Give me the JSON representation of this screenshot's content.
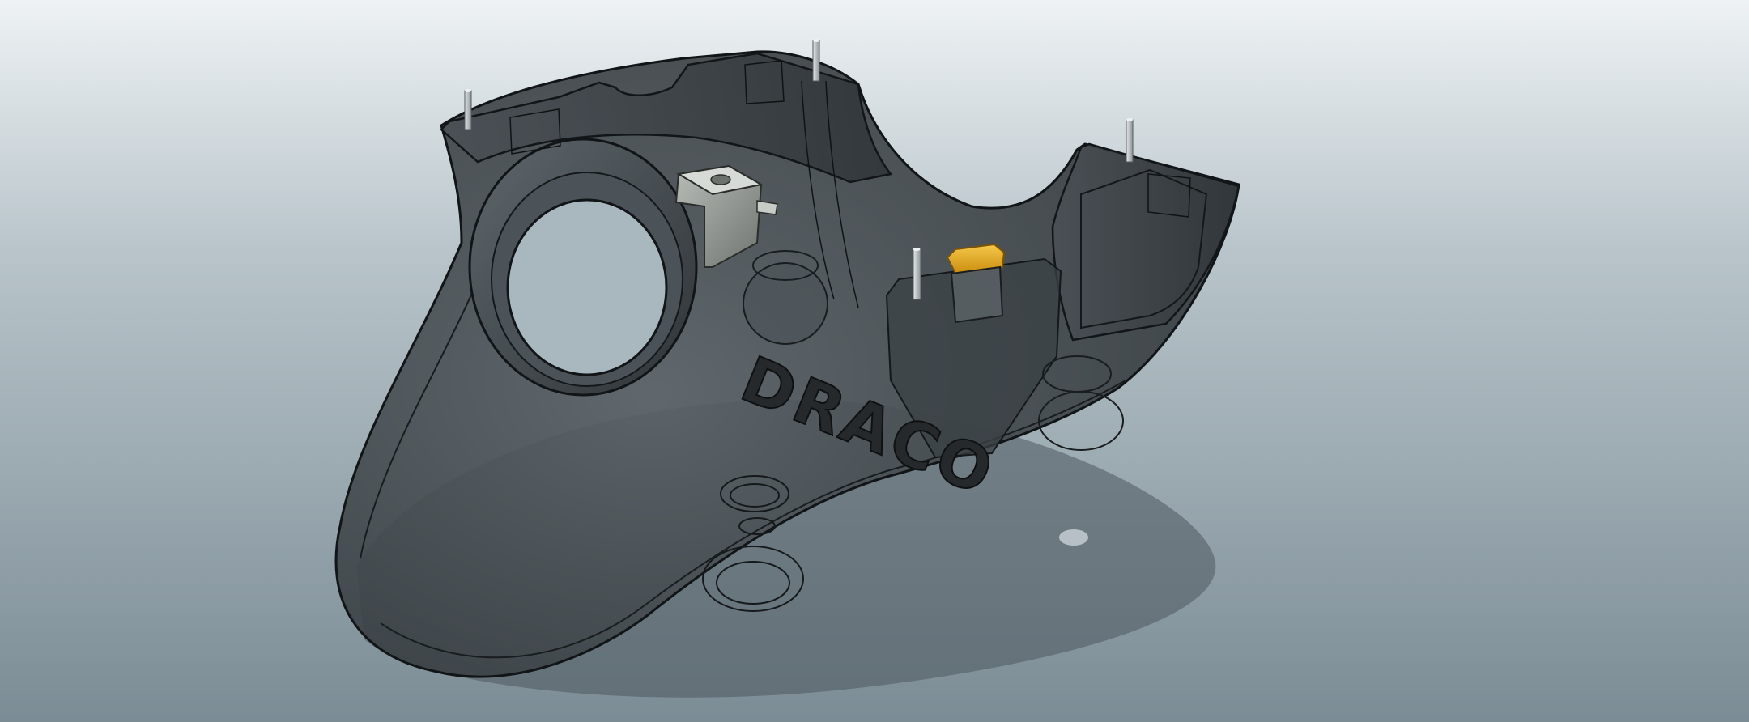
{
  "viewport": {
    "background_top": "#e9eef1",
    "background_bottom": "#7f8f98"
  },
  "model": {
    "shell_color": "#3f4549",
    "shell_edge": "#141719",
    "bracket_color": "#8c918c",
    "pin_color": "#b9bfc3",
    "clip_color": "#e8b02c",
    "engraving_text": "DRACO"
  }
}
